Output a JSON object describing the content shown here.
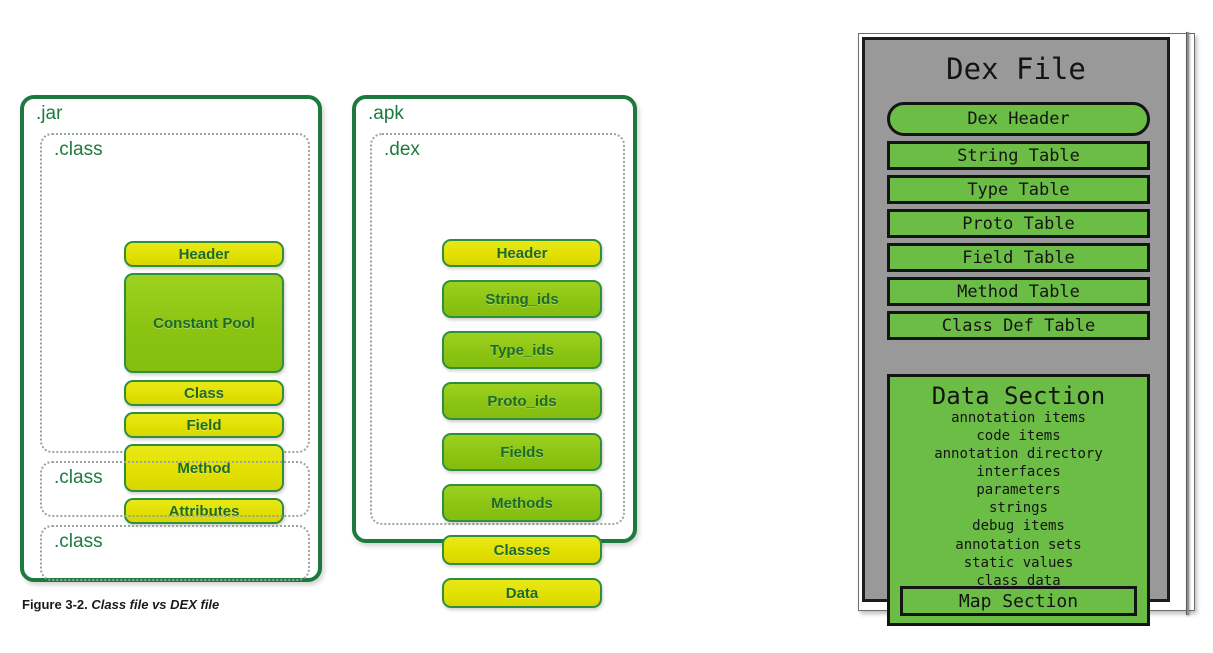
{
  "figure": {
    "caption_number": "Figure 3-2.",
    "caption_title": "Class file vs DEX file"
  },
  "jar": {
    "label": ".jar",
    "class_boxes": [
      {
        "label": ".class",
        "expanded": true
      },
      {
        "label": ".class",
        "expanded": false
      },
      {
        "label": ".class",
        "expanded": false
      }
    ],
    "sections": [
      {
        "label": "Header",
        "color": "yellow"
      },
      {
        "label": "Constant Pool",
        "color": "green"
      },
      {
        "label": "Class",
        "color": "yellow"
      },
      {
        "label": "Field",
        "color": "yellow"
      },
      {
        "label": "Method",
        "color": "yellow"
      },
      {
        "label": "Attributes",
        "color": "yellow"
      }
    ]
  },
  "apk": {
    "label": ".apk",
    "dex_label": ".dex",
    "sections": [
      {
        "label": "Header",
        "color": "yellow"
      },
      {
        "label": "String_ids",
        "color": "green"
      },
      {
        "label": "Type_ids",
        "color": "green"
      },
      {
        "label": "Proto_ids",
        "color": "green"
      },
      {
        "label": "Fields",
        "color": "green"
      },
      {
        "label": "Methods",
        "color": "green"
      },
      {
        "label": "Classes",
        "color": "yellow"
      },
      {
        "label": "Data",
        "color": "yellow"
      }
    ]
  },
  "dex_file": {
    "title": "Dex File",
    "rows": [
      {
        "label": "Dex Header",
        "rounded": true
      },
      {
        "label": "String Table",
        "rounded": false
      },
      {
        "label": "Type Table",
        "rounded": false
      },
      {
        "label": "Proto Table",
        "rounded": false
      },
      {
        "label": "Field Table",
        "rounded": false
      },
      {
        "label": "Method Table",
        "rounded": false
      },
      {
        "label": "Class Def Table",
        "rounded": false
      }
    ],
    "data_section": {
      "title": "Data Section",
      "items": [
        "annotation items",
        "code items",
        "annotation directory",
        "interfaces",
        "parameters",
        "strings",
        "debug items",
        "annotation sets",
        "static values",
        "class data"
      ],
      "map_section": "Map Section"
    }
  },
  "colors": {
    "container_border": "#1d7a3e",
    "pill_yellow": "#e2e000",
    "pill_green": "#8cc413",
    "pill_border": "#2f8f3e",
    "dex_panel_bg": "#999999",
    "dex_row_green": "#6cbd45",
    "dex_outline": "#141414"
  }
}
